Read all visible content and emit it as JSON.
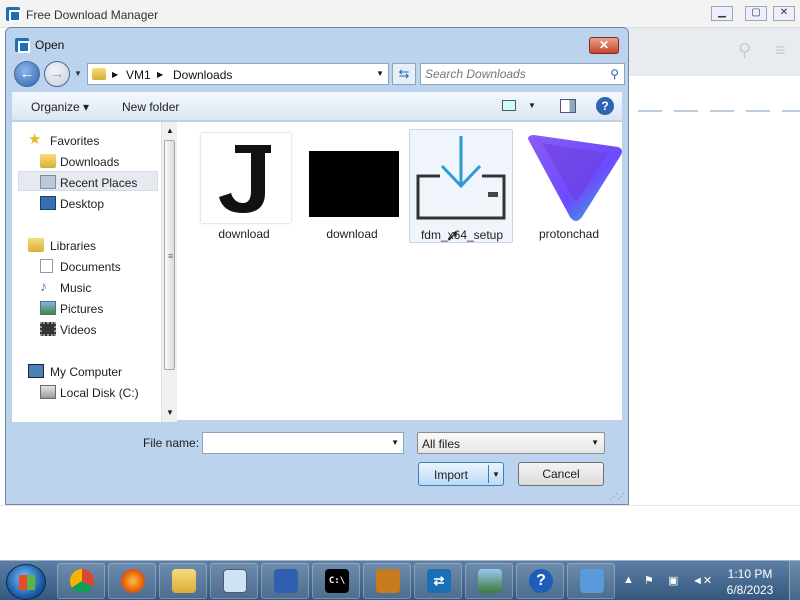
{
  "app": {
    "title": "Free Download Manager"
  },
  "dialog": {
    "title": "Open",
    "close_label": "✕",
    "address": {
      "crumbs": [
        "VM1",
        "Downloads"
      ],
      "sep": "▶"
    },
    "search_placeholder": "Search Downloads",
    "command_bar": {
      "organize": "Organize ▾",
      "new_folder": "New folder",
      "help": "?"
    },
    "nav_pane": {
      "favorites": "Favorites",
      "downloads": "Downloads",
      "recent_places": "Recent Places",
      "desktop": "Desktop",
      "libraries": "Libraries",
      "documents": "Documents",
      "music": "Music",
      "pictures": "Pictures",
      "videos": "Videos",
      "my_computer": "My Computer",
      "local_disk": "Local Disk (C:)"
    },
    "files": [
      {
        "name": "download",
        "kind": "letter-j"
      },
      {
        "name": "download",
        "kind": "black"
      },
      {
        "name": "fdm_x64_setup",
        "kind": "fdm-setup"
      },
      {
        "name": "protonchad",
        "kind": "proton-vpn"
      }
    ],
    "file_name_label": "File name:",
    "file_name_value": "",
    "filter": "All files",
    "import_label": "Import",
    "cancel_label": "Cancel"
  },
  "taskbar": {
    "apps": [
      "chrome-icon",
      "firefox-icon",
      "explorer-icon",
      "notepad-icon",
      "network-icon",
      "cmd-icon",
      "installer-icon",
      "fdm-icon",
      "photos-icon",
      "help-icon",
      "control-panel-icon"
    ],
    "time": "1:10 PM",
    "date": "6/8/2023"
  },
  "colors": {
    "accent": "#2d65b0",
    "titlebar": "#bcd3ee",
    "taskbar": "#33587e",
    "fdm_blue": "#1a6fb5"
  }
}
